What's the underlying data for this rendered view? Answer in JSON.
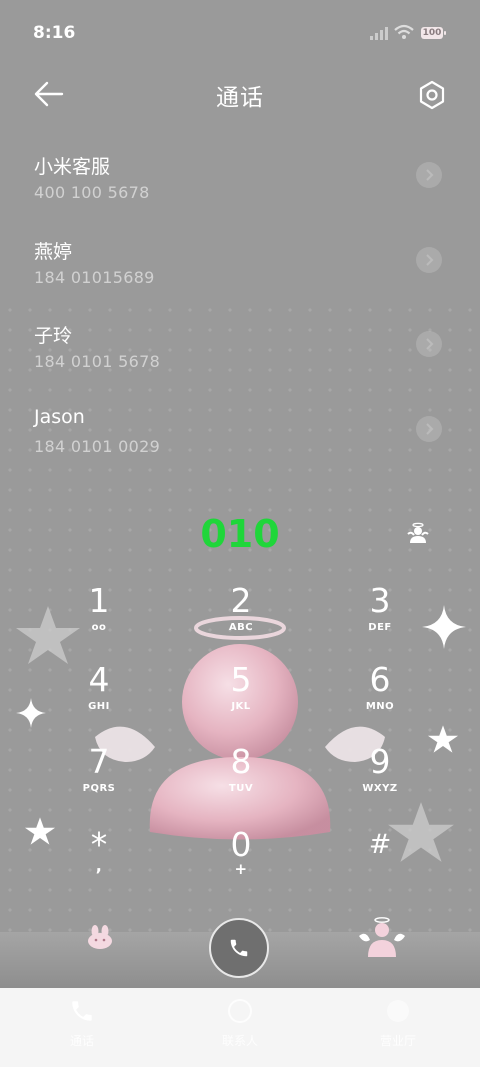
{
  "status": {
    "time": "8:16",
    "battery": "100"
  },
  "header": {
    "title": "通话",
    "back_icon": "arrow-left-icon",
    "settings_icon": "gear-icon"
  },
  "contacts": [
    {
      "name": "小米客服",
      "number": "400 100 5678"
    },
    {
      "name": "燕婷",
      "number": "184 01015689"
    },
    {
      "name": "子玲",
      "number": "184 0101 5678"
    },
    {
      "name": "Jason",
      "number": "184 0101 0029"
    }
  ],
  "dialer": {
    "input": "010",
    "input_color": "#1fd63a",
    "keys": [
      {
        "num": "1",
        "letters": "oo"
      },
      {
        "num": "2",
        "letters": "ABC"
      },
      {
        "num": "3",
        "letters": "DEF"
      },
      {
        "num": "4",
        "letters": "GHI"
      },
      {
        "num": "5",
        "letters": "JKL"
      },
      {
        "num": "6",
        "letters": "MNO"
      },
      {
        "num": "7",
        "letters": "PQRS"
      },
      {
        "num": "8",
        "letters": "TUV"
      },
      {
        "num": "9",
        "letters": "WXYZ"
      },
      {
        "num": "*",
        "letters": ","
      },
      {
        "num": "0",
        "letters": "+"
      },
      {
        "num": "#",
        "letters": ""
      }
    ]
  },
  "tabs": [
    {
      "label": "通话",
      "icon": "phone-icon"
    },
    {
      "label": "联系人",
      "icon": "contacts-icon"
    },
    {
      "label": "营业厅",
      "icon": "store-icon"
    }
  ]
}
